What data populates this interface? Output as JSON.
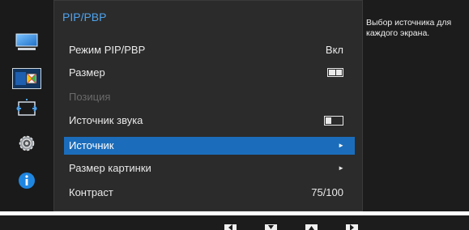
{
  "menu": {
    "title": "PIP/PBP",
    "items": [
      {
        "label": "Режим PIP/PBP",
        "value": "Вкл"
      },
      {
        "label": "Размер",
        "value_icon": "split-screen-icon"
      },
      {
        "label": "Позиция",
        "state": "disabled"
      },
      {
        "label": "Источник звука",
        "value_icon": "sound-source-icon"
      },
      {
        "label": "Источник",
        "state": "selected",
        "value_icon": "arrow-right-icon"
      },
      {
        "label": "Размер картинки",
        "value_icon": "arrow-right-icon"
      },
      {
        "label": "Контраст",
        "value": "75/100"
      }
    ]
  },
  "help_text": "Выбор источника для каждого экрана.",
  "sidebar": {
    "icons": [
      "picture-icon",
      "pip-pbp-icon",
      "onscreen-display-icon",
      "settings-icon",
      "information-icon"
    ],
    "active_index": 1
  },
  "bottom_buttons": [
    "left-button-icon",
    "down-button-icon",
    "up-button-icon",
    "right-button-icon"
  ],
  "colors": {
    "accent": "#1b6dbb",
    "title": "#4ea3ee",
    "panel": "#2b2b2b",
    "background": "#1c1c1c"
  }
}
